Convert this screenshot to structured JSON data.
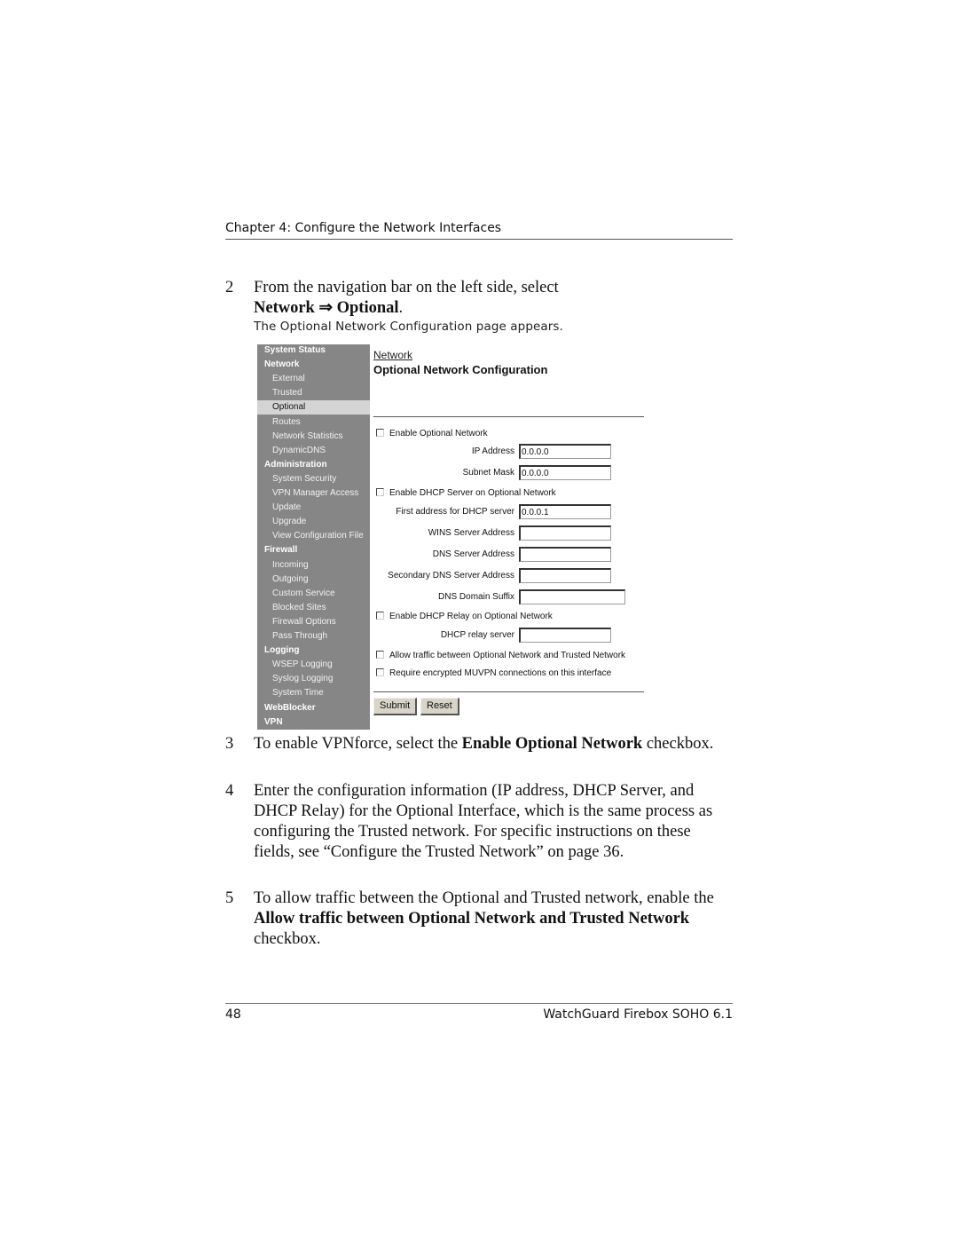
{
  "header": {
    "chapter_title": "Chapter 4: Configure the Network Interfaces"
  },
  "steps": [
    {
      "number": "2",
      "pre": "From the navigation bar on the left side, select",
      "bold1": "Network",
      "arrow": " ⇒ ",
      "bold2": "Optional",
      "post": "."
    },
    {
      "number": "3",
      "pre": "To enable VPNforce, select the ",
      "bold": "Enable Optional Network",
      "post": " checkbox."
    },
    {
      "number": "4",
      "text": "Enter the configuration information (IP address, DHCP Server, and DHCP Relay) for the Optional Interface, which is the same process as configuring the Trusted network. For specific instructions on these fields, see “Configure the Trusted Network” on page 36."
    },
    {
      "number": "5",
      "pre": "To allow traffic between the Optional and Trusted network, enable the ",
      "bold": "Allow traffic between Optional Network and Trusted Network",
      "post": " checkbox."
    }
  ],
  "caption": "The Optional Network Configuration page appears.",
  "ui": {
    "sidebar": [
      {
        "label": "System Status",
        "type": "section"
      },
      {
        "label": "Network",
        "type": "section"
      },
      {
        "label": "External",
        "type": "sub"
      },
      {
        "label": "Trusted",
        "type": "sub"
      },
      {
        "label": "Optional",
        "type": "sub",
        "selected": true
      },
      {
        "label": "Routes",
        "type": "sub"
      },
      {
        "label": "Network Statistics",
        "type": "sub"
      },
      {
        "label": "DynamicDNS",
        "type": "sub"
      },
      {
        "label": "Administration",
        "type": "section"
      },
      {
        "label": "System Security",
        "type": "sub"
      },
      {
        "label": "VPN Manager Access",
        "type": "sub"
      },
      {
        "label": "Update",
        "type": "sub"
      },
      {
        "label": "Upgrade",
        "type": "sub"
      },
      {
        "label": "View Configuration File",
        "type": "sub"
      },
      {
        "label": "Firewall",
        "type": "section"
      },
      {
        "label": "Incoming",
        "type": "sub"
      },
      {
        "label": "Outgoing",
        "type": "sub"
      },
      {
        "label": "Custom Service",
        "type": "sub"
      },
      {
        "label": "Blocked Sites",
        "type": "sub"
      },
      {
        "label": "Firewall Options",
        "type": "sub"
      },
      {
        "label": "Pass Through",
        "type": "sub"
      },
      {
        "label": "Logging",
        "type": "section"
      },
      {
        "label": "WSEP Logging",
        "type": "sub"
      },
      {
        "label": "Syslog Logging",
        "type": "sub"
      },
      {
        "label": "System Time",
        "type": "sub"
      },
      {
        "label": "WebBlocker",
        "type": "section"
      },
      {
        "label": "VPN",
        "type": "section"
      }
    ],
    "breadcrumb": "Network",
    "title": "Optional Network Configuration",
    "checkboxes": {
      "enable_optional": {
        "label": "Enable Optional Network",
        "checked": false
      },
      "enable_dhcp_server": {
        "label": "Enable DHCP Server on Optional Network",
        "checked": false
      },
      "enable_dhcp_relay": {
        "label": "Enable DHCP Relay on Optional Network",
        "checked": false
      },
      "allow_traffic": {
        "label": "Allow traffic between Optional Network and Trusted Network",
        "checked": false
      },
      "require_muvpn": {
        "label": "Require encrypted MUVPN connections on this interface",
        "checked": false
      }
    },
    "fields": {
      "ip_address": {
        "label": "IP Address",
        "value": "0.0.0.0"
      },
      "subnet_mask": {
        "label": "Subnet Mask",
        "value": "0.0.0.0"
      },
      "dhcp_first": {
        "label": "First address for DHCP server",
        "value": "0.0.0.1"
      },
      "wins": {
        "label": "WINS Server Address",
        "value": ""
      },
      "dns": {
        "label": "DNS Server Address",
        "value": ""
      },
      "dns2": {
        "label": "Secondary DNS Server Address",
        "value": ""
      },
      "dns_suffix": {
        "label": "DNS Domain Suffix",
        "value": ""
      },
      "relay": {
        "label": "DHCP relay server",
        "value": ""
      }
    },
    "buttons": {
      "submit": "Submit",
      "reset": "Reset"
    }
  },
  "footer": {
    "page_number": "48",
    "product": "WatchGuard Firebox SOHO 6.1"
  }
}
